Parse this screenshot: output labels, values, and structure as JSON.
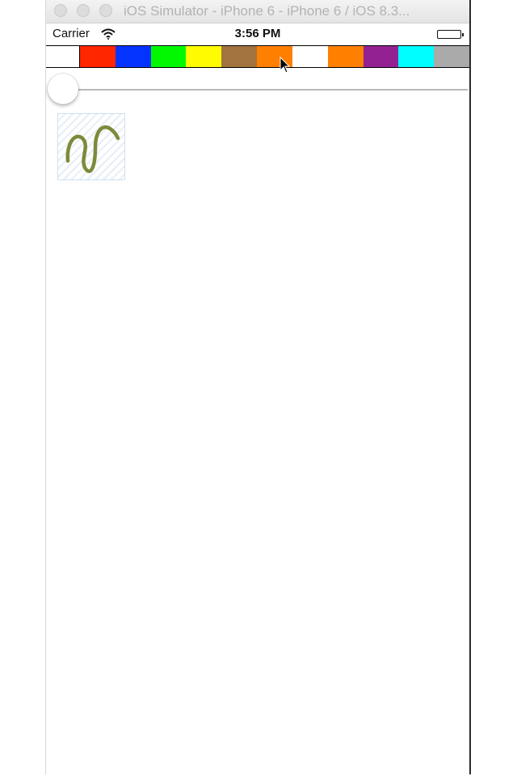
{
  "window": {
    "title": "iOS Simulator - iPhone 6 - iPhone 6 / iOS 8.3..."
  },
  "status_bar": {
    "carrier": "Carrier",
    "time": "3:56 PM"
  },
  "palette": {
    "colors": [
      "#ff2600",
      "#0433ff",
      "#00f900",
      "#fffb00",
      "#a2733f",
      "#ff8000",
      "#ffffff",
      "#ff8000",
      "#942192",
      "#00fdff",
      "#aaaaaa"
    ],
    "hovered_index": 4
  },
  "brush_slider": {
    "value": 0
  },
  "thumbnail": {
    "stroke_color": "#7d8a3a"
  }
}
